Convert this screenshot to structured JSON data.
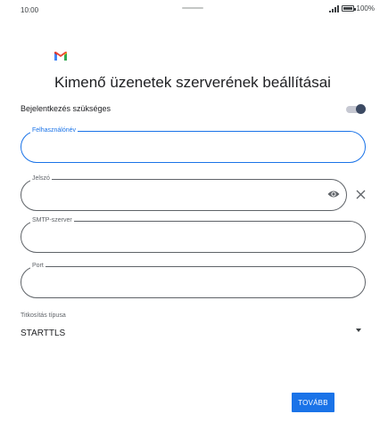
{
  "status_bar": {
    "time": "10:00",
    "battery_text": "100%",
    "icons": [
      "signal-icon",
      "battery-icon"
    ]
  },
  "header": {
    "logo": "gmail-logo",
    "title": "Kimenő üzenetek szerverének beállításai"
  },
  "signin_toggle": {
    "label": "Bejelentkezés szükséges",
    "on": true
  },
  "fields": {
    "username": {
      "label": "Felhasználónév",
      "value": "",
      "focused": true
    },
    "password": {
      "label": "Jelszó",
      "value": ""
    },
    "smtp_server": {
      "label": "SMTP-szerver",
      "value": ""
    },
    "port": {
      "label": "Port",
      "value": ""
    }
  },
  "encryption": {
    "label": "Titkosítás típusa",
    "selected": "STARTTLS"
  },
  "actions": {
    "next_label": "TOVÁBB"
  },
  "colors": {
    "accent": "#1a73e8",
    "toggle_thumb": "#3c4a63",
    "toggle_track": "#c6c8d2",
    "outline": "#5f6368"
  }
}
